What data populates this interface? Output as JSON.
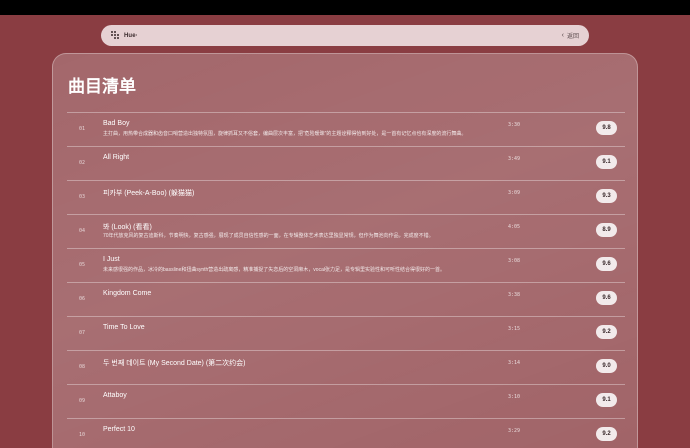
{
  "header": {
    "brand": "Hue·",
    "back_label": "返回"
  },
  "page_title": "曲目清单",
  "tracks": [
    {
      "num": "01",
      "title": "Bad Boy",
      "desc": "主打曲，用热带合成器和齿音口哨营造出独特氛围，旋律抓耳又不俗套，编曲层次丰富，把“危险暧昧”的主题诠释得恰到好处，是一首有记忆点也有深度的流行舞曲。",
      "duration": "3:30",
      "score": "9.8"
    },
    {
      "num": "02",
      "title": "All Right",
      "desc": "",
      "duration": "3:49",
      "score": "9.1"
    },
    {
      "num": "03",
      "title": "피카부 (Peek-A-Boo) (躲猫猫)",
      "desc": "",
      "duration": "3:09",
      "score": "9.3"
    },
    {
      "num": "04",
      "title": "봐 (Look) (看看)",
      "desc": "70年代放克风的复古迪斯科，节奏明快，复古感强，展现了成员自信性感的一面，在专辑整体艺术表达里独显常规，但作为舞池向作品，完成度不错。",
      "duration": "4:05",
      "score": "8.9"
    },
    {
      "num": "05",
      "title": "I Just",
      "desc": "未来感很强的作品，冰冷的bassline和扭曲synth营造出疏离感，精准捕捉了失恋后的空洞麻木，vocal张力足，是专辑里实验性和可听性结合得很好的一首。",
      "duration": "3:08",
      "score": "9.6"
    },
    {
      "num": "06",
      "title": "Kingdom Come",
      "desc": "",
      "duration": "3:38",
      "score": "9.6"
    },
    {
      "num": "07",
      "title": "Time To Love",
      "desc": "",
      "duration": "3:15",
      "score": "9.2"
    },
    {
      "num": "08",
      "title": "두 번째 데이트 (My Second Date) (第二次约会)",
      "desc": "",
      "duration": "3:14",
      "score": "9.0"
    },
    {
      "num": "09",
      "title": "Attaboy",
      "desc": "",
      "duration": "3:10",
      "score": "9.1"
    },
    {
      "num": "10",
      "title": "Perfect 10",
      "desc": "",
      "duration": "3:29",
      "score": "9.2"
    }
  ]
}
